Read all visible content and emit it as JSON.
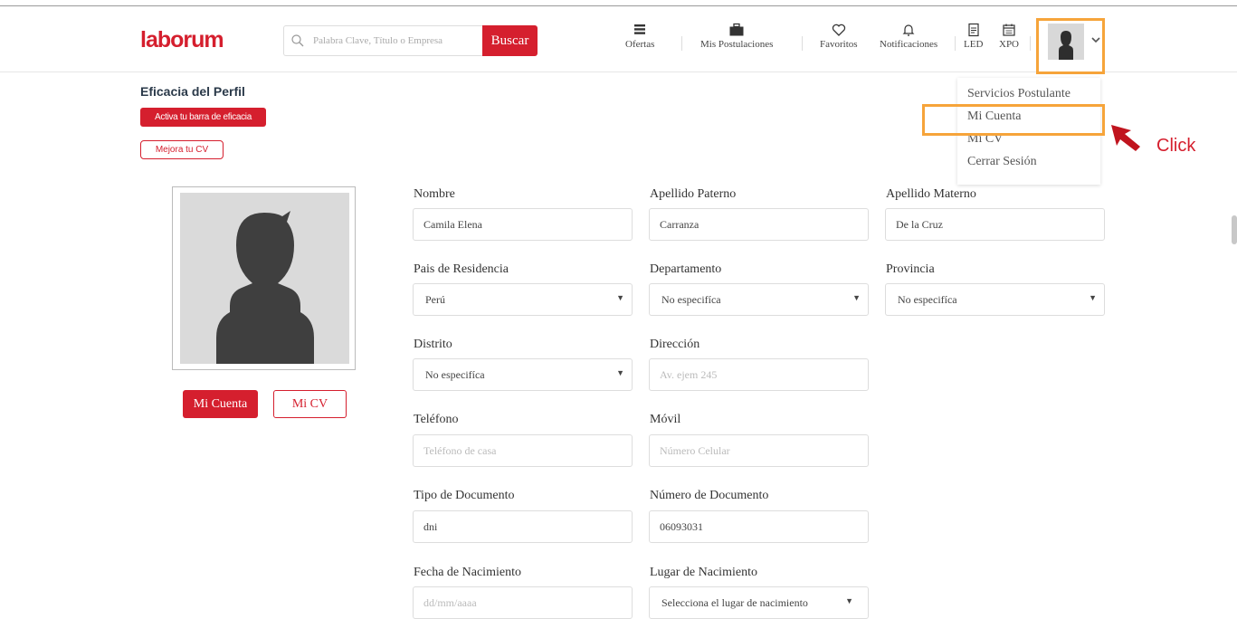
{
  "brand": {
    "logo": "laborum",
    "accent": "#d51f2e",
    "highlight": "#f6a43a"
  },
  "search": {
    "placeholder": "Palabra Clave, Título o Empresa",
    "button": "Buscar"
  },
  "nav": {
    "ofertas": {
      "label": "Ofertas",
      "icon": "list-icon"
    },
    "postulaciones": {
      "label": "Mis Postulaciones",
      "icon": "briefcase-icon"
    },
    "favoritos": {
      "label": "Favoritos",
      "icon": "heart-icon"
    },
    "notificaciones": {
      "label": "Notificaciones",
      "icon": "bell-icon"
    },
    "led": {
      "label": "LED",
      "icon": "document-icon"
    },
    "xpo": {
      "label": "XPO",
      "icon": "calendar-icon"
    }
  },
  "dropdown": {
    "items": [
      "Servicios Postulante",
      "Mi Cuenta",
      "Mi CV",
      "Cerrar Sesión"
    ]
  },
  "annotation": {
    "click": "Click"
  },
  "sidebar": {
    "title": "Eficacia del Perfil",
    "activate": "Activa tu barra de eficacia",
    "improve": "Mejora tu CV",
    "mi_cuenta": "Mi Cuenta",
    "mi_cv": "Mi CV"
  },
  "form": {
    "nombre": {
      "label": "Nombre",
      "value": "Camila Elena"
    },
    "apellido_paterno": {
      "label": "Apellido Paterno",
      "value": "Carranza"
    },
    "apellido_materno": {
      "label": "Apellido Materno",
      "value": "De la Cruz"
    },
    "pais": {
      "label": "Pais de Residencia",
      "value": "Perú"
    },
    "departamento": {
      "label": "Departamento",
      "value": "No especifíca"
    },
    "provincia": {
      "label": "Provincia",
      "value": "No especifíca"
    },
    "distrito": {
      "label": "Distrito",
      "value": "No especifíca"
    },
    "direccion": {
      "label": "Dirección",
      "placeholder": "Av. ejem 245"
    },
    "telefono": {
      "label": "Teléfono",
      "placeholder": "Teléfono de casa"
    },
    "movil": {
      "label": "Móvil",
      "placeholder": "Número Celular"
    },
    "tipo_documento": {
      "label": "Tipo de Documento",
      "value": "dni"
    },
    "numero_documento": {
      "label": "Número de Documento",
      "value": "06093031"
    },
    "fecha_nacimiento": {
      "label": "Fecha de Nacimiento",
      "placeholder": "dd/mm/aaaa"
    },
    "lugar_nacimiento": {
      "label": "Lugar de Nacimiento",
      "value": "Selecciona el lugar de nacimiento"
    }
  }
}
